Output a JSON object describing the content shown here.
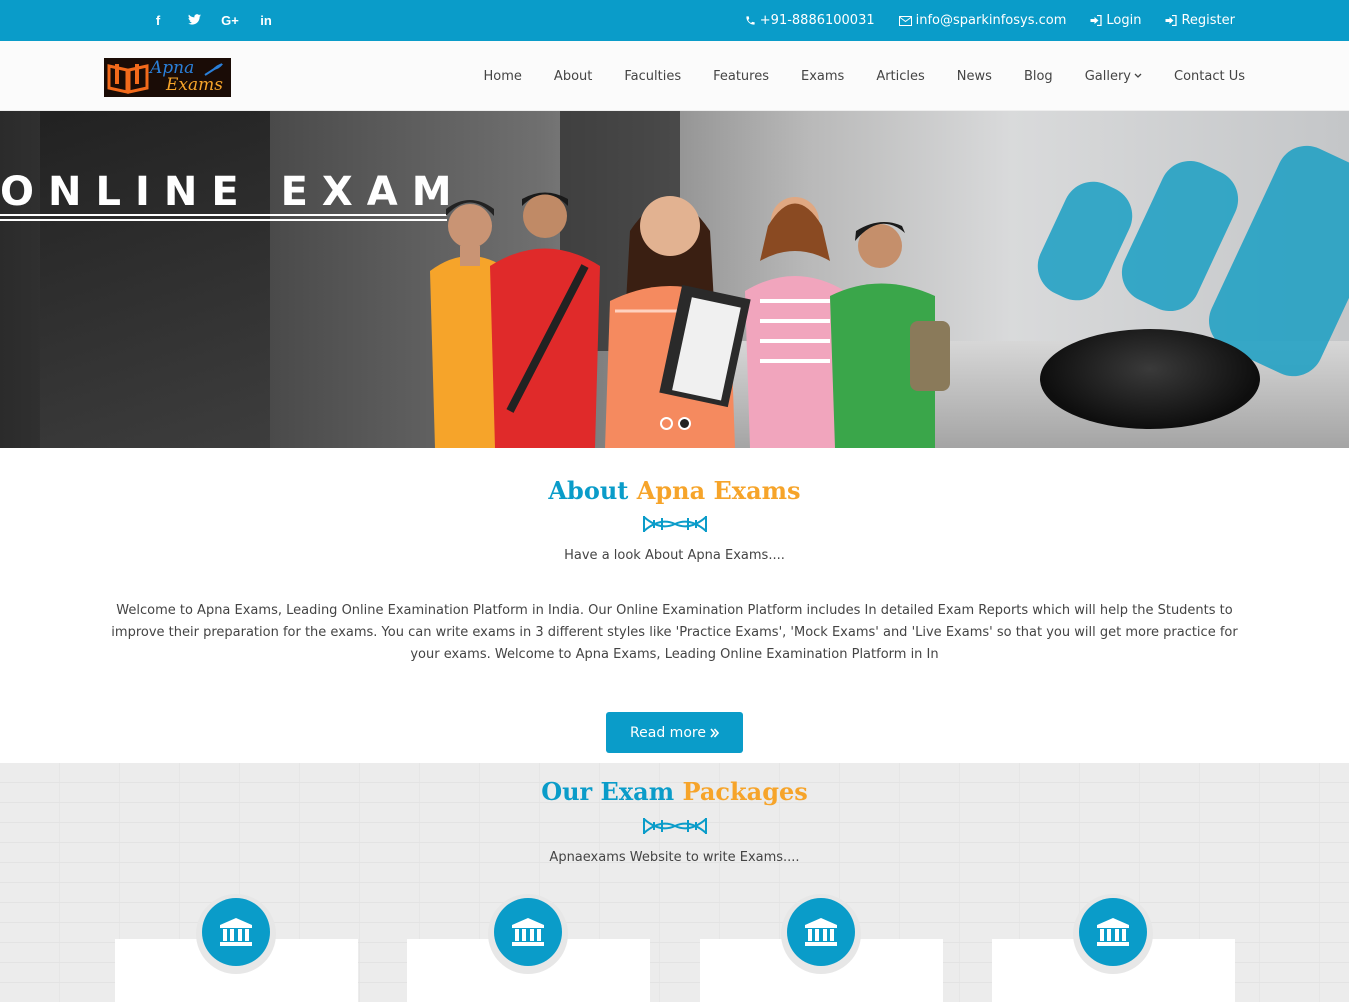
{
  "topbar": {
    "social": [
      "f",
      "t",
      "G+",
      "in"
    ],
    "phone": "+91-8886100031",
    "email": "info@sparkinfosys.com",
    "login": "Login",
    "register": "Register"
  },
  "logo": {
    "line1": "Apna",
    "line2": "Exams"
  },
  "nav": {
    "items": [
      "Home",
      "About",
      "Faculties",
      "Features",
      "Exams",
      "Articles",
      "News",
      "Blog",
      "Gallery",
      "Contact Us"
    ]
  },
  "hero": {
    "title": "ONLINE EXAM",
    "slides": 2,
    "active_slide": 2
  },
  "about": {
    "title_part1": "About",
    "title_part2": "Apna Exams",
    "subtitle": "Have a look About Apna Exams....",
    "text": "Welcome to Apna Exams, Leading Online Examination Platform in India. Our Online Examination Platform includes In detailed Exam Reports which will help the Students to improve their preparation for the exams. You can write exams in 3 different styles like 'Practice Exams', 'Mock Exams' and 'Live Exams' so that you will get more practice for your exams. Welcome to Apna Exams, Leading Online Examination Platform in In",
    "button": "Read more"
  },
  "packages": {
    "title_part1": "Our Exam",
    "title_part2": "Packages",
    "subtitle": "Apnaexams Website to write Exams...."
  },
  "colors": {
    "primary": "#0a9cc9",
    "accent": "#f6a42a"
  }
}
